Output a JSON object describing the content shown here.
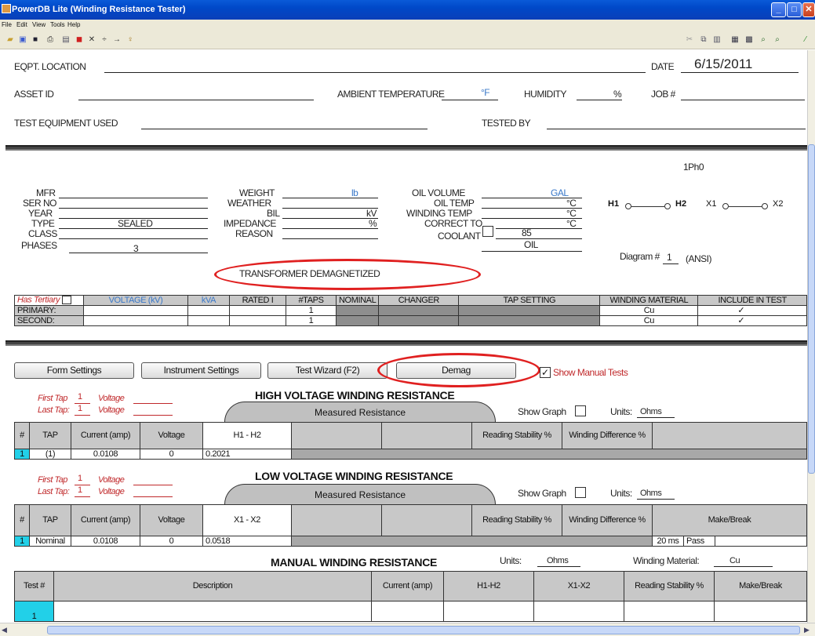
{
  "window": {
    "title": "PowerDB Lite (Winding Resistance Tester)"
  },
  "menu": [
    "File",
    "Edit",
    "View",
    "Tools",
    "Help"
  ],
  "header": {
    "eqpt_location_label": "EQPT. LOCATION",
    "date_label": "DATE",
    "date_value": "6/15/2011",
    "asset_id_label": "ASSET ID",
    "ambient_temp_label": "AMBIENT TEMPERATURE",
    "ambient_temp_unit": "°F",
    "humidity_label": "HUMIDITY",
    "humidity_unit": "%",
    "job_label": "JOB #",
    "test_equipment_label": "TEST EQUIPMENT USED",
    "tested_by_label": "TESTED BY"
  },
  "nameplate": {
    "phase_code": "1Ph0",
    "mfr": "MFR",
    "ser_no": "SER NO",
    "year": "YEAR",
    "type": "TYPE",
    "type_value": "SEALED",
    "class": "CLASS",
    "phases": "PHASES",
    "phases_value": "3",
    "weight": "WEIGHT",
    "weight_unit": "lb",
    "weather": "WEATHER",
    "bil": "BIL",
    "bil_unit": "kV",
    "impedance": "IMPEDANCE",
    "impedance_unit": "%",
    "reason": "REASON",
    "oil_volume": "OIL VOLUME",
    "oil_volume_unit": "GAL",
    "oil_temp": "OIL TEMP",
    "oil_temp_unit": "°C",
    "winding_temp": "WINDING TEMP",
    "winding_temp_unit": "°C",
    "correct_to": "CORRECT TO",
    "correct_to_value": "85",
    "correct_to_unit": "°C",
    "coolant": "COOLANT",
    "coolant_value": "OIL",
    "diagram_label": "Diagram #",
    "diagram_value": "1",
    "diagram_std": "(ANSI)",
    "demag_status": "TRANSFORMER DEMAGNETIZED",
    "diagram_h1": "H1",
    "diagram_h2": "H2",
    "diagram_x1": "X1",
    "diagram_x2": "X2"
  },
  "winding_table": {
    "has_tertiary": "Has Tertiary",
    "headers": [
      "VOLTAGE (kV)",
      "kVA",
      "RATED I",
      "#TAPS",
      "NOMINAL",
      "CHANGER",
      "TAP SETTING",
      "WINDING MATERIAL",
      "INCLUDE IN TEST"
    ],
    "rows": [
      {
        "name": "PRIMARY:",
        "taps": "1",
        "material": "Cu",
        "include": "✓"
      },
      {
        "name": "SECOND:",
        "taps": "1",
        "material": "Cu",
        "include": "✓"
      }
    ]
  },
  "buttons": {
    "form_settings": "Form Settings",
    "instrument_settings": "Instrument Settings",
    "test_wizard": "Test Wizard (F2)",
    "demag": "Demag",
    "show_manual_tests": "Show Manual Tests",
    "show_manual_checked": "✓"
  },
  "hv": {
    "title": "HIGH VOLTAGE WINDING RESISTANCE",
    "first_tap_label": "First Tap",
    "first_tap": "1",
    "last_tap_label": "Last Tap:",
    "last_tap": "1",
    "voltage_label": "Voltage",
    "measured_resistance": "Measured Resistance",
    "show_graph": "Show Graph",
    "units_label": "Units:",
    "units_value": "Ohms",
    "col_num": "#",
    "col_tap": "TAP",
    "col_current": "Current (amp)",
    "col_voltage": "Voltage",
    "col_h1h2": "H1 - H2",
    "col_stability": "Reading Stability %",
    "col_difference": "Winding Difference %",
    "row": {
      "num": "1",
      "tap": "(1)",
      "current": "0.0108",
      "voltage": "0",
      "h1h2": "0.2021"
    }
  },
  "lv": {
    "title": "LOW VOLTAGE WINDING RESISTANCE",
    "first_tap_label": "First Tap",
    "first_tap": "1",
    "last_tap_label": "Last Tap:",
    "last_tap": "1",
    "voltage_label": "Voltage",
    "measured_resistance": "Measured Resistance",
    "show_graph": "Show Graph",
    "units_label": "Units:",
    "units_value": "Ohms",
    "col_num": "#",
    "col_tap": "TAP",
    "col_current": "Current (amp)",
    "col_voltage": "Voltage",
    "col_x1x2": "X1 - X2",
    "col_stability": "Reading Stability %",
    "col_difference": "Winding Difference %",
    "col_makebreak": "Make/Break",
    "row": {
      "num": "1",
      "tap": "Nominal",
      "current": "0.0108",
      "voltage": "0",
      "x1x2": "0.0518",
      "mb_time": "20 ms",
      "mb_result": "Pass"
    }
  },
  "manual": {
    "title": "MANUAL WINDING RESISTANCE",
    "units_label": "Units:",
    "units_value": "Ohms",
    "material_label": "Winding Material:",
    "material_value": "Cu",
    "headers": [
      "Test #",
      "Description",
      "Current (amp)",
      "H1-H2",
      "X1-X2",
      "Reading Stability %",
      "Make/Break"
    ],
    "row_num": "1"
  }
}
